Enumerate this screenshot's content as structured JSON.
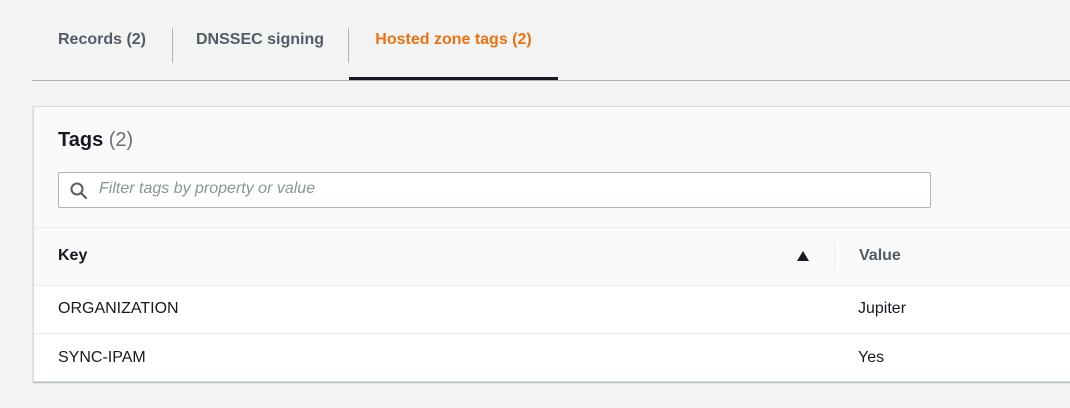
{
  "tabs": [
    {
      "label": "Records (2)"
    },
    {
      "label": "DNSSEC signing"
    },
    {
      "label": "Hosted zone tags (2)",
      "active": true
    }
  ],
  "accent_color": "#ec7211",
  "panel": {
    "title": "Tags",
    "count": "(2)",
    "filter": {
      "placeholder": "Filter tags by property or value",
      "value": ""
    }
  },
  "table": {
    "columns": [
      "Key",
      "Value"
    ],
    "sort": {
      "column": "Key",
      "direction": "ascending",
      "icon": "caret-up-icon"
    },
    "rows": [
      {
        "key": "ORGANIZATION",
        "value": "Jupiter"
      },
      {
        "key": "SYNC-IPAM",
        "value": "Yes"
      }
    ]
  }
}
